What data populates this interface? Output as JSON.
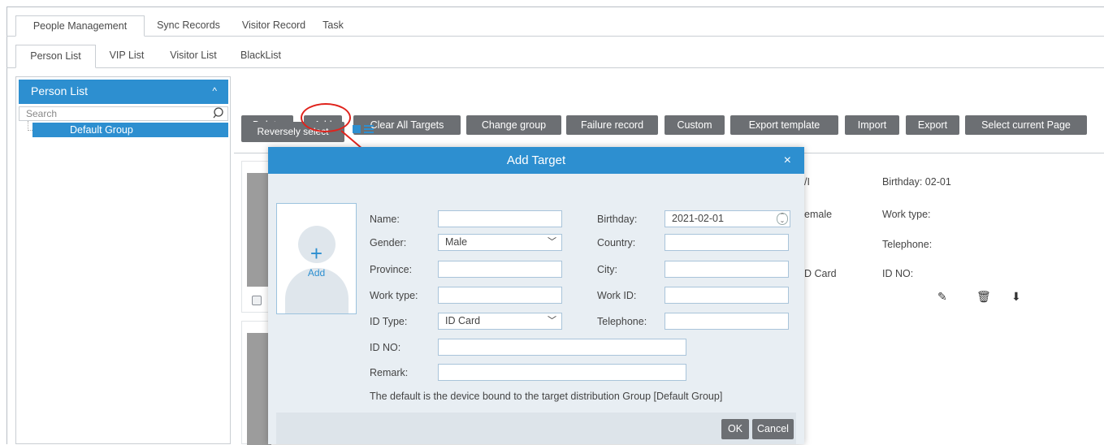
{
  "tabs_main": [
    "People Management",
    "Sync Records",
    "Visitor Record",
    "Task"
  ],
  "tabs_sub": [
    "Person List",
    "VIP List",
    "Visitor List",
    "BlackList"
  ],
  "left_panel": {
    "title": "Person List",
    "search_placeholder": "Search",
    "group": "Default Group"
  },
  "toolbar": {
    "buttons": [
      "Delete",
      "Add",
      "Clear All Targets",
      "Change group",
      "Failure record",
      "Custom",
      "Export template",
      "Import",
      "Export",
      "Select current Page"
    ],
    "reverse_select": "Reversely select"
  },
  "card_info": {
    "col1": [
      "/I",
      "emale",
      "",
      "D Card"
    ],
    "col2": [
      "Birthday:   02-01",
      "Work type:",
      "Telephone:",
      "ID NO:"
    ]
  },
  "dialog": {
    "title": "Add Target",
    "photo_add": "Add",
    "labels": {
      "name": "Name:",
      "gender": "Gender:",
      "province": "Province:",
      "work_type": "Work type:",
      "id_type": "ID Type:",
      "id_no": "ID NO:",
      "remark": "Remark:",
      "birthday": "Birthday:",
      "country": "Country:",
      "city": "City:",
      "work_id": "Work ID:",
      "telephone": "Telephone:"
    },
    "values": {
      "gender": "Male",
      "birthday": "2021-02-01",
      "id_type": "ID Card"
    },
    "note": "The default is the device bound to the target distribution Group [Default Group]",
    "ok": "OK",
    "cancel": "Cancel"
  },
  "colors": {
    "accent": "#2d8fd0",
    "button": "#6c6f73",
    "highlight": "#e0231c"
  }
}
